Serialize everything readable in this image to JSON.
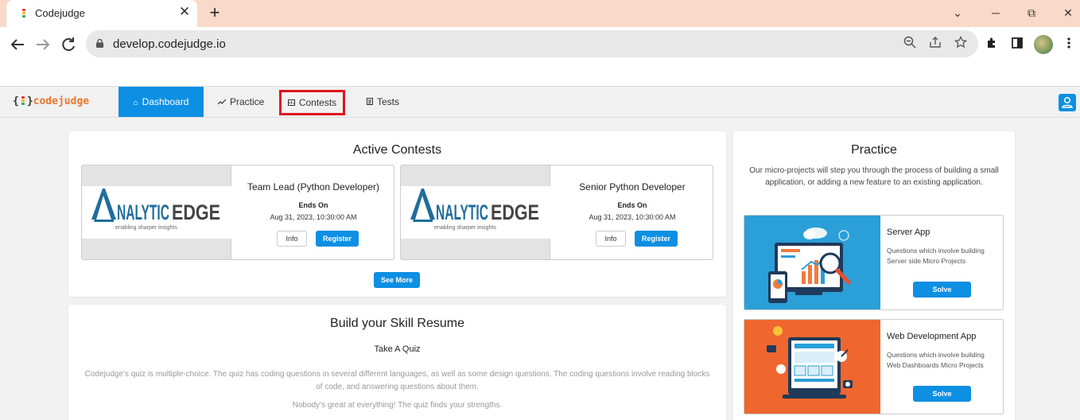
{
  "browser": {
    "tab_title": "Codejudge",
    "tab_close": "✕",
    "new_tab": "+",
    "url": "develop.codejudge.io",
    "window_controls": {
      "minimize": "⌄",
      "restore": "─",
      "maximize": "⧉",
      "close": "✕"
    }
  },
  "app": {
    "logo_left": "{",
    "logo_right": "}",
    "logo_text": "codejudge",
    "nav": {
      "dashboard": "Dashboard",
      "practice": "Practice",
      "contests": "Contests",
      "tests": "Tests"
    }
  },
  "active_contests": {
    "title": "Active Contests",
    "see_more": "See More",
    "contests": [
      {
        "name": "Team Lead (Python Developer)",
        "ends_label": "Ends On",
        "ends_date": "Aug 31, 2023, 10:30:00 AM",
        "info": "Info",
        "register": "Register",
        "logo_main": "NALYTIC",
        "logo_edge": "EDGE",
        "logo_tagline": "enabling sharper insights"
      },
      {
        "name": "Senior Python Developer",
        "ends_label": "Ends On",
        "ends_date": "Aug 31, 2023, 10:30:00 AM",
        "info": "Info",
        "register": "Register",
        "logo_main": "NALYTIC",
        "logo_edge": "EDGE",
        "logo_tagline": "enabling sharper insights"
      }
    ]
  },
  "skill_resume": {
    "title": "Build your Skill Resume",
    "subtitle": "Take A Quiz",
    "description": "Codejudge's quiz is multiple-choice. The quiz has coding questions in several different languages, as well as some design questions. The coding questions involve reading blocks of code, and answering questions about them.",
    "note": "Nobody's great at everything! The quiz finds your strengths."
  },
  "practice": {
    "title": "Practice",
    "description": "Our micro-projects will step you through the process of building a small application, or adding a new feature to an existing application.",
    "items": [
      {
        "title": "Server App",
        "description": "Questions which involve building Server side Micro Projects",
        "button": "Solve"
      },
      {
        "title": "Web Development App",
        "description": "Questions which involve building Web Dashboards Micro Projects",
        "button": "Solve"
      }
    ]
  },
  "colors": {
    "primary": "#0d8fe3",
    "tabstrip": "#f9d9c7",
    "highlight_box": "#e0141f",
    "logo_orange": "#e8772e"
  }
}
